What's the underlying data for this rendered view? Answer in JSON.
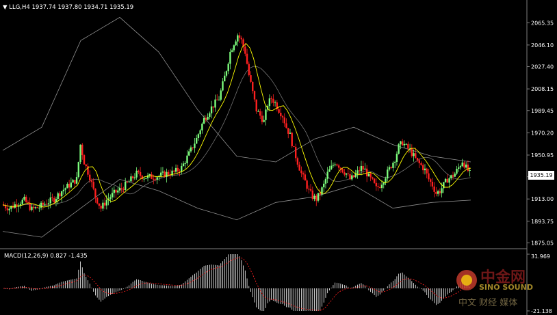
{
  "header": {
    "title": "LLG,H4",
    "ohlc": "1937.74 1937.80 1934.71 1935.19",
    "indicator": "MACD(12,26,9) 0.827 -1.435"
  },
  "price_tag": "1935.19",
  "watermark": {
    "brand_cn": "中金网",
    "brand_en": "SINO SOUND",
    "slogan": "中文 财经 媒体"
  },
  "colors": {
    "background": "#000000",
    "bull": "#7cfc7c",
    "bear": "#ff2020",
    "signal": "#ffff00",
    "bands": "#c0c0c0",
    "macd": "#ffffff",
    "macd_signal": "#ff2020"
  },
  "chart_data": [
    {
      "type": "candlestick",
      "symbol": "LLG,H4",
      "ylim": [
        1870,
        2085
      ],
      "yticks": [
        1875.05,
        1893.75,
        1913.0,
        1932.25,
        1950.95,
        1970.2,
        1989.45,
        2008.15,
        2027.4,
        2046.1,
        2065.35
      ],
      "last": 1935.19,
      "close_path": [
        [
          0,
          1908
        ],
        [
          4,
          1905
        ],
        [
          8,
          1909
        ],
        [
          12,
          1912
        ],
        [
          16,
          1904
        ],
        [
          20,
          1906
        ],
        [
          24,
          1910
        ],
        [
          28,
          1913
        ],
        [
          32,
          1920
        ],
        [
          36,
          1925
        ],
        [
          40,
          1930
        ],
        [
          42,
          1960
        ],
        [
          44,
          1945
        ],
        [
          47,
          1932
        ],
        [
          50,
          1915
        ],
        [
          53,
          1905
        ],
        [
          56,
          1912
        ],
        [
          60,
          1918
        ],
        [
          64,
          1922
        ],
        [
          68,
          1928
        ],
        [
          72,
          1935
        ],
        [
          76,
          1932
        ],
        [
          80,
          1932
        ],
        [
          84,
          1933
        ],
        [
          88,
          1935
        ],
        [
          92,
          1936
        ],
        [
          96,
          1940
        ],
        [
          100,
          1952
        ],
        [
          104,
          1965
        ],
        [
          108,
          1982
        ],
        [
          112,
          1992
        ],
        [
          116,
          2000
        ],
        [
          118,
          2012
        ],
        [
          120,
          2025
        ],
        [
          122,
          2040
        ],
        [
          124,
          2048
        ],
        [
          126,
          2055
        ],
        [
          128,
          2050
        ],
        [
          130,
          2040
        ],
        [
          132,
          2020
        ],
        [
          134,
          2005
        ],
        [
          136,
          1990
        ],
        [
          138,
          1985
        ],
        [
          140,
          1980
        ],
        [
          142,
          1995
        ],
        [
          144,
          2000
        ],
        [
          146,
          1996
        ],
        [
          148,
          1990
        ],
        [
          150,
          1985
        ],
        [
          152,
          1975
        ],
        [
          154,
          1968
        ],
        [
          156,
          1955
        ],
        [
          158,
          1945
        ],
        [
          160,
          1935
        ],
        [
          162,
          1928
        ],
        [
          164,
          1920
        ],
        [
          166,
          1915
        ],
        [
          168,
          1913
        ],
        [
          170,
          1918
        ],
        [
          172,
          1925
        ],
        [
          174,
          1935
        ],
        [
          176,
          1940
        ],
        [
          178,
          1945
        ],
        [
          180,
          1942
        ],
        [
          182,
          1938
        ],
        [
          184,
          1935
        ],
        [
          186,
          1930
        ],
        [
          188,
          1932
        ],
        [
          190,
          1936
        ],
        [
          192,
          1940
        ],
        [
          194,
          1938
        ],
        [
          196,
          1932
        ],
        [
          198,
          1928
        ],
        [
          200,
          1922
        ],
        [
          202,
          1925
        ],
        [
          204,
          1930
        ],
        [
          206,
          1936
        ],
        [
          208,
          1942
        ],
        [
          210,
          1948
        ],
        [
          212,
          1958
        ],
        [
          214,
          1962
        ],
        [
          216,
          1958
        ],
        [
          218,
          1955
        ],
        [
          220,
          1950
        ],
        [
          222,
          1945
        ],
        [
          224,
          1942
        ],
        [
          226,
          1938
        ],
        [
          228,
          1930
        ],
        [
          230,
          1925
        ],
        [
          232,
          1918
        ],
        [
          234,
          1920
        ],
        [
          236,
          1925
        ],
        [
          238,
          1930
        ],
        [
          240,
          1932
        ],
        [
          242,
          1935
        ],
        [
          244,
          1940
        ],
        [
          246,
          1946
        ],
        [
          248,
          1940
        ],
        [
          250,
          1935
        ]
      ],
      "bollinger": {
        "upper": [
          1955,
          1975,
          2050,
          2070,
          2040,
          1990,
          1950,
          1945,
          1965,
          1975,
          1960,
          1950,
          1945
        ],
        "lower": [
          1885,
          1880,
          1905,
          1930,
          1920,
          1905,
          1895,
          1910,
          1915,
          1925,
          1905,
          1910,
          1912
        ]
      }
    },
    {
      "type": "bar",
      "name": "MACD(12,26,9)",
      "values": [
        0.827,
        -1.435
      ],
      "ylim": [
        -21.138,
        31.969
      ],
      "yticks": [
        31.969,
        -21.138
      ]
    }
  ]
}
